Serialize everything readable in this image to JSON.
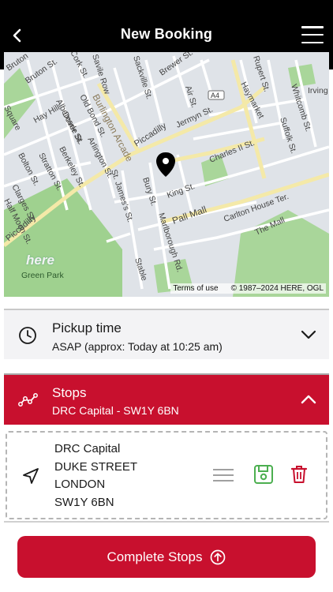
{
  "header": {
    "title": "New Booking"
  },
  "map": {
    "labels": {
      "burlington_arcade": "Burlington Arcade",
      "piccadilly": "Piccadilly",
      "piccadilly_left": "Piccadilly",
      "jermyn": "Jermyn St.",
      "charles": "Charles II St.",
      "king": "King St.",
      "pall_mall": "Pall Mall",
      "carlton": "Carlton House Ter.",
      "the_mall": "The Mall",
      "haymarket": "Haymarket",
      "green_park": "Green Park",
      "st_james": "St. James's St.",
      "bury": "Bury St.",
      "marlborough": "Marlborough Rd.",
      "hay_hill": "Hay Hill",
      "albemarle": "Albemarle St.",
      "dover": "Dover St.",
      "berkeley": "Berkeley St.",
      "stratton": "Stratton St.",
      "bolton": "Bolton St.",
      "clarges": "Clarges St.",
      "half_moon": "Half Moon St.",
      "arlington": "Arlington St.",
      "old_bond": "Old Bond St.",
      "sackville": "Sackville St.",
      "air": "Air St.",
      "brewer": "Brewer St.",
      "rupert": "Rupert St.",
      "whitcomb": "Whitcomb St.",
      "suffolk": "Suffolk St.",
      "irving": "Irving",
      "bruton": "Bruton St.",
      "bruton_pl": "Bruton",
      "square": "Square",
      "cork": "Cork St.",
      "savile": "Savile Row",
      "stable": "Stable",
      "a4": "A4"
    },
    "logo": "here",
    "terms": "Terms of use",
    "copyright": "© 1987–2024 HERE, OGL"
  },
  "pickup": {
    "title": "Pickup time",
    "value": "ASAP (approx: Today at 10:25 am)"
  },
  "stops": {
    "title": "Stops",
    "summary": "DRC Capital - SW1Y 6BN",
    "items": [
      {
        "name": "DRC Capital",
        "street": "DUKE STREET",
        "city": "LONDON",
        "postcode": "SW1Y 6BN"
      }
    ]
  },
  "complete_button": {
    "label": "Complete Stops"
  },
  "colors": {
    "brand_red": "#c8102e",
    "header_bg": "#000000",
    "save_green": "#4caf50"
  }
}
